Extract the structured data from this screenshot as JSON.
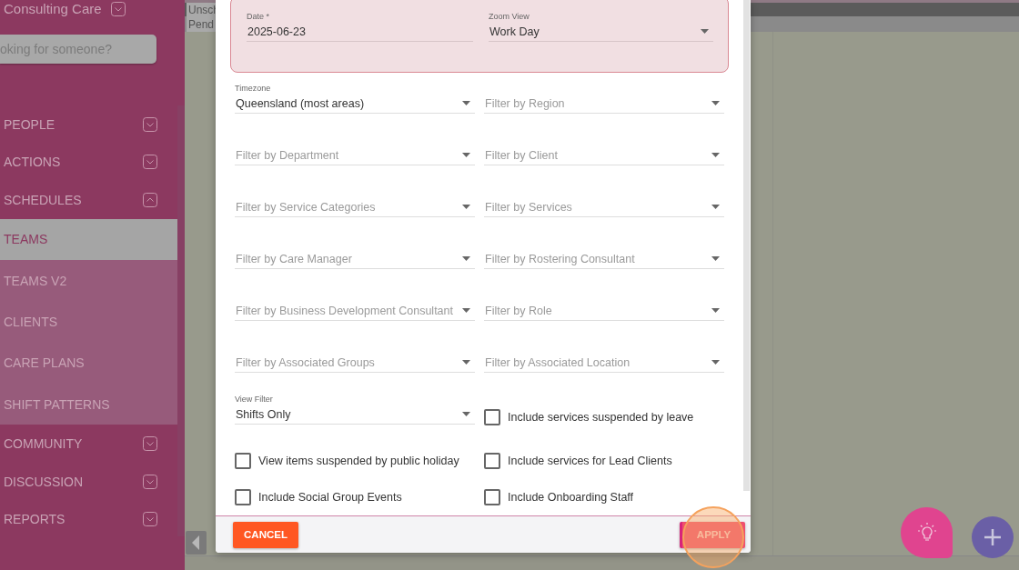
{
  "sidebar": {
    "brand": "Consulting Care",
    "search": {
      "placeholder": "oking for someone?"
    },
    "items": [
      {
        "label": "PEOPLE",
        "expanded": false,
        "selected": false
      },
      {
        "label": "ACTIONS",
        "expanded": false,
        "selected": false
      },
      {
        "label": "SCHEDULES",
        "expanded": true,
        "selected": false,
        "children": [
          {
            "label": "TEAMS",
            "selected": true
          },
          {
            "label": "TEAMS V2",
            "selected": false
          },
          {
            "label": "CLIENTS",
            "selected": false
          },
          {
            "label": "CARE PLANS",
            "selected": false
          },
          {
            "label": "SHIFT PATTERNS",
            "selected": false
          }
        ]
      },
      {
        "label": "COMMUNITY",
        "expanded": false,
        "selected": false
      },
      {
        "label": "DISCUSSION",
        "expanded": false,
        "selected": false
      },
      {
        "label": "REPORTS",
        "expanded": false,
        "selected": false
      }
    ]
  },
  "schedule": {
    "row_labels": [
      "Unsch",
      "Pend"
    ]
  },
  "dialog": {
    "header_fields": [
      {
        "kind": "text",
        "label": "Date *",
        "value": "2025-06-23"
      },
      {
        "kind": "select",
        "label": "Zoom View",
        "value": "Work Day"
      }
    ],
    "filters": [
      {
        "kind": "select",
        "label": "Timezone",
        "value": "Queensland (most areas)"
      },
      {
        "kind": "select",
        "placeholder": "Filter by Region"
      },
      {
        "kind": "select",
        "placeholder": "Filter by Department"
      },
      {
        "kind": "select",
        "placeholder": "Filter by Client"
      },
      {
        "kind": "select",
        "placeholder": "Filter by Service Categories"
      },
      {
        "kind": "select",
        "placeholder": "Filter by Services"
      },
      {
        "kind": "select",
        "placeholder": "Filter by Care Manager"
      },
      {
        "kind": "select",
        "placeholder": "Filter by Rostering Consultant"
      },
      {
        "kind": "select",
        "placeholder": "Filter by Business Development Consultant"
      },
      {
        "kind": "select",
        "placeholder": "Filter by Role"
      },
      {
        "kind": "select",
        "placeholder": "Filter by Associated Groups"
      },
      {
        "kind": "select",
        "placeholder": "Filter by Associated Location"
      },
      {
        "kind": "select",
        "label": "View Filter",
        "value": "Shifts Only"
      },
      {
        "kind": "checkbox",
        "label": "Include services suspended by leave",
        "checked": false
      },
      {
        "kind": "checkbox",
        "label": "View items suspended by public holiday",
        "checked": false
      },
      {
        "kind": "checkbox",
        "label": "Include services for Lead Clients",
        "checked": false
      },
      {
        "kind": "checkbox",
        "label": "Include Social Group Events",
        "checked": false
      },
      {
        "kind": "checkbox",
        "label": "Include Onboarding Staff",
        "checked": false
      }
    ],
    "buttons": [
      {
        "kind": "cancel",
        "label": "CANCEL",
        "highlighted": false
      },
      {
        "kind": "apply",
        "label": "APPLY",
        "highlighted": true
      }
    ]
  }
}
